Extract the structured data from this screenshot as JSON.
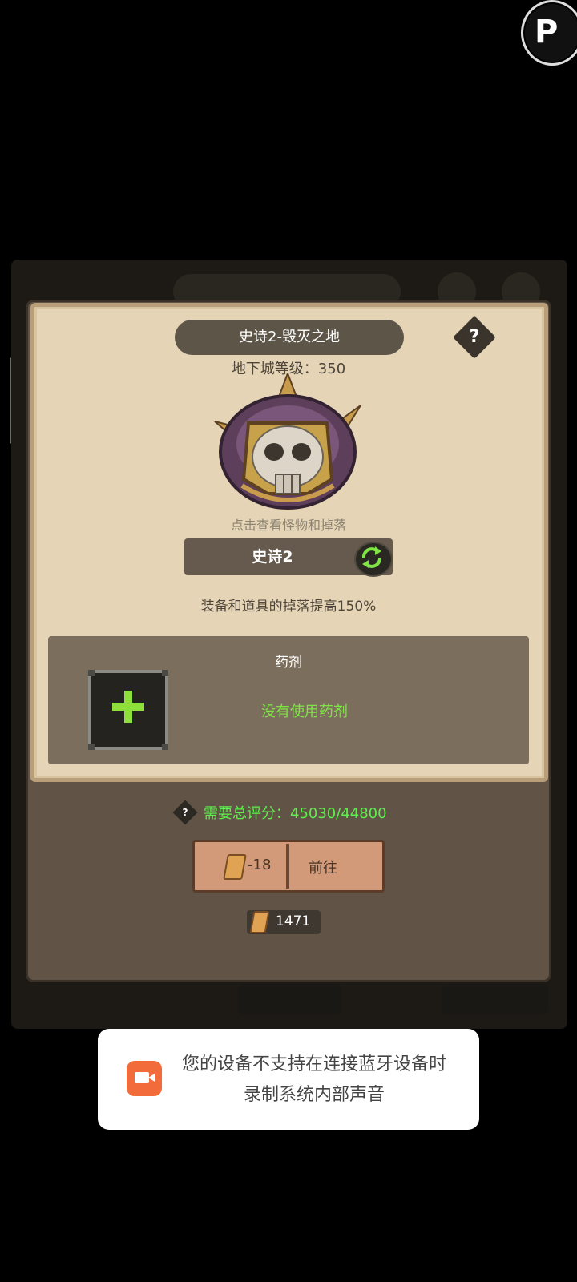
{
  "dialog": {
    "title": "史诗2-毁灭之地",
    "help_symbol": "?",
    "dungeon_level": "地下城等级：350",
    "boss_caption": "点击查看怪物和掉落",
    "difficulty": "史诗2",
    "drop_bonus": "装备和道具的掉落提高150%",
    "potion": {
      "title": "药剂",
      "status": "没有使用药剂"
    },
    "score_help_symbol": "?",
    "required_score": "需要总评分：45030/44800",
    "go_button": {
      "cost": "-18",
      "label": "前往"
    },
    "ticket_count": "1471"
  },
  "toast": {
    "message": "您的设备不支持在连接蓝牙设备时录制系统内部声音",
    "icon": "screen-record-icon"
  },
  "colors": {
    "accent_green": "#7fe545",
    "score_green": "#5df04d",
    "toast_icon": "#f26b3a"
  }
}
